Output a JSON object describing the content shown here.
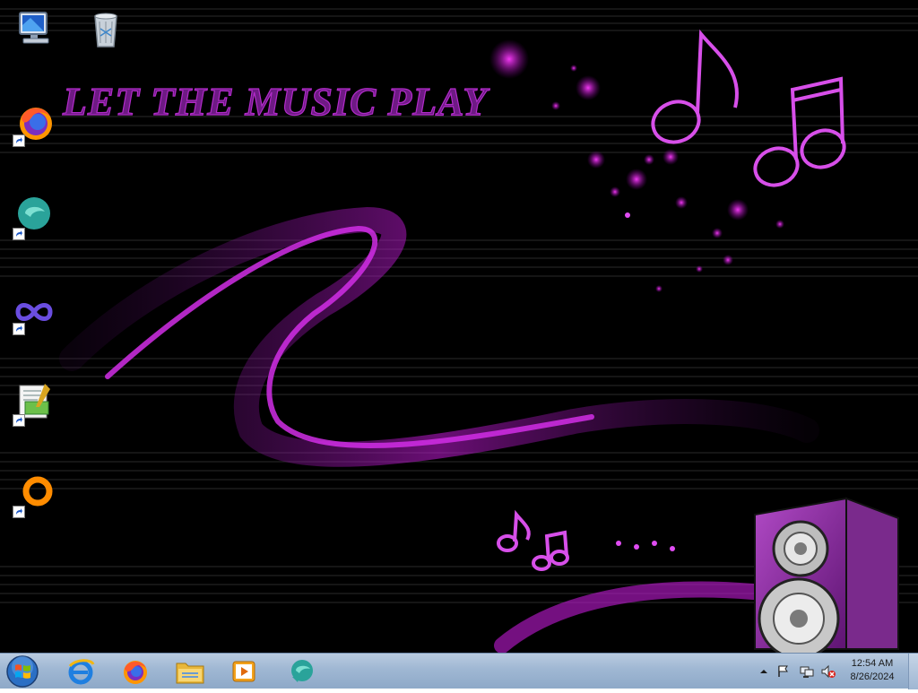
{
  "wallpaper": {
    "title_text": "LET THE MUSIC PLAY",
    "accent_color": "#c018d8"
  },
  "desktop_icons": [
    {
      "name": "computer-icon",
      "shortcut": false
    },
    {
      "name": "recycle-bin-icon",
      "shortcut": false
    },
    {
      "name": "firefox-icon",
      "shortcut": true
    },
    {
      "name": "chat-app-icon",
      "shortcut": true
    },
    {
      "name": "infinity-app-icon",
      "shortcut": true
    },
    {
      "name": "text-editor-icon",
      "shortcut": true
    },
    {
      "name": "orange-ring-app-icon",
      "shortcut": true
    }
  ],
  "taskbar": {
    "pinned": [
      "internet-explorer-icon",
      "firefox-icon",
      "file-explorer-icon",
      "media-player-icon",
      "chat-app-icon"
    ],
    "tray": [
      "show-hidden-icons",
      "action-center-flag-icon",
      "network-icon",
      "volume-muted-icon"
    ],
    "clock": {
      "time": "12:54 AM",
      "date": "8/26/2024"
    }
  }
}
